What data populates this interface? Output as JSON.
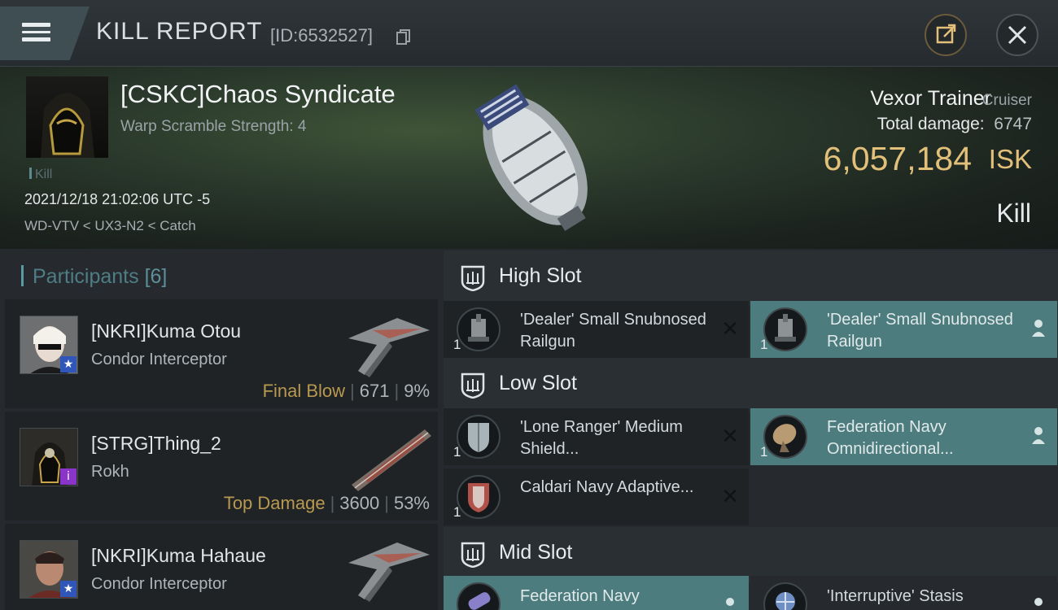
{
  "header": {
    "title": "KILL REPORT",
    "kill_id": "[ID:6532527]"
  },
  "victim": {
    "corp_name": "[CSKC]Chaos Syndicate",
    "warp_scramble": "Warp Scramble Strength: 4",
    "kill_tag": "Kill",
    "datetime": "2021/12/18 21:02:06 UTC -5",
    "location": "WD-VTV < UX3-N2 < Catch",
    "ship_name": "Vexor Trainer",
    "ship_class": "Cruiser",
    "total_damage_label": "Total damage:",
    "total_damage": "6747",
    "isk_value": "6,057,184",
    "isk_currency": "ISK",
    "result": "Kill"
  },
  "participants": {
    "label": "Participants",
    "count": "[6]",
    "items": [
      {
        "name": "[NKRI]Kuma Otou",
        "ship": "Condor Interceptor",
        "label": "Final Blow",
        "damage": "671",
        "percent": "9%",
        "badge": "star"
      },
      {
        "name": "[STRG]Thing_2",
        "ship": "Rokh",
        "label": "Top Damage",
        "damage": "3600",
        "percent": "53%",
        "badge": "info"
      },
      {
        "name": "[NKRI]Kuma Hahaue",
        "ship": "Condor Interceptor",
        "label": "",
        "damage": "",
        "percent": "",
        "badge": "star"
      }
    ]
  },
  "slots": {
    "high": {
      "label": "High Slot",
      "items": [
        {
          "name": "'Dealer' Small Snubnosed Railgun",
          "qty": "1",
          "state": "destroyed"
        },
        {
          "name": "'Dealer' Small Snubnosed Railgun",
          "qty": "1",
          "state": "dropped"
        }
      ]
    },
    "low": {
      "label": "Low Slot",
      "items": [
        {
          "name": "'Lone Ranger' Medium Shield...",
          "qty": "1",
          "state": "destroyed"
        },
        {
          "name": "Federation Navy Omnidirectional...",
          "qty": "1",
          "state": "dropped"
        },
        {
          "name": "Caldari Navy Adaptive...",
          "qty": "1",
          "state": "destroyed"
        }
      ]
    },
    "mid": {
      "label": "Mid Slot",
      "items": [
        {
          "name": "Federation Navy",
          "qty": "",
          "state": "dropped"
        },
        {
          "name": "'Interruptive' Stasis",
          "qty": "",
          "state": "destroyed"
        }
      ]
    }
  },
  "colors": {
    "accent_gold": "#e3c07a",
    "dropped_teal": "#4c7c7d",
    "destroyed_dark": "#1f2326"
  },
  "icons": [
    "menu-icon",
    "copy-icon",
    "share-icon",
    "close-icon",
    "slot-shield-icon",
    "person-icon",
    "destroyed-x-icon"
  ]
}
